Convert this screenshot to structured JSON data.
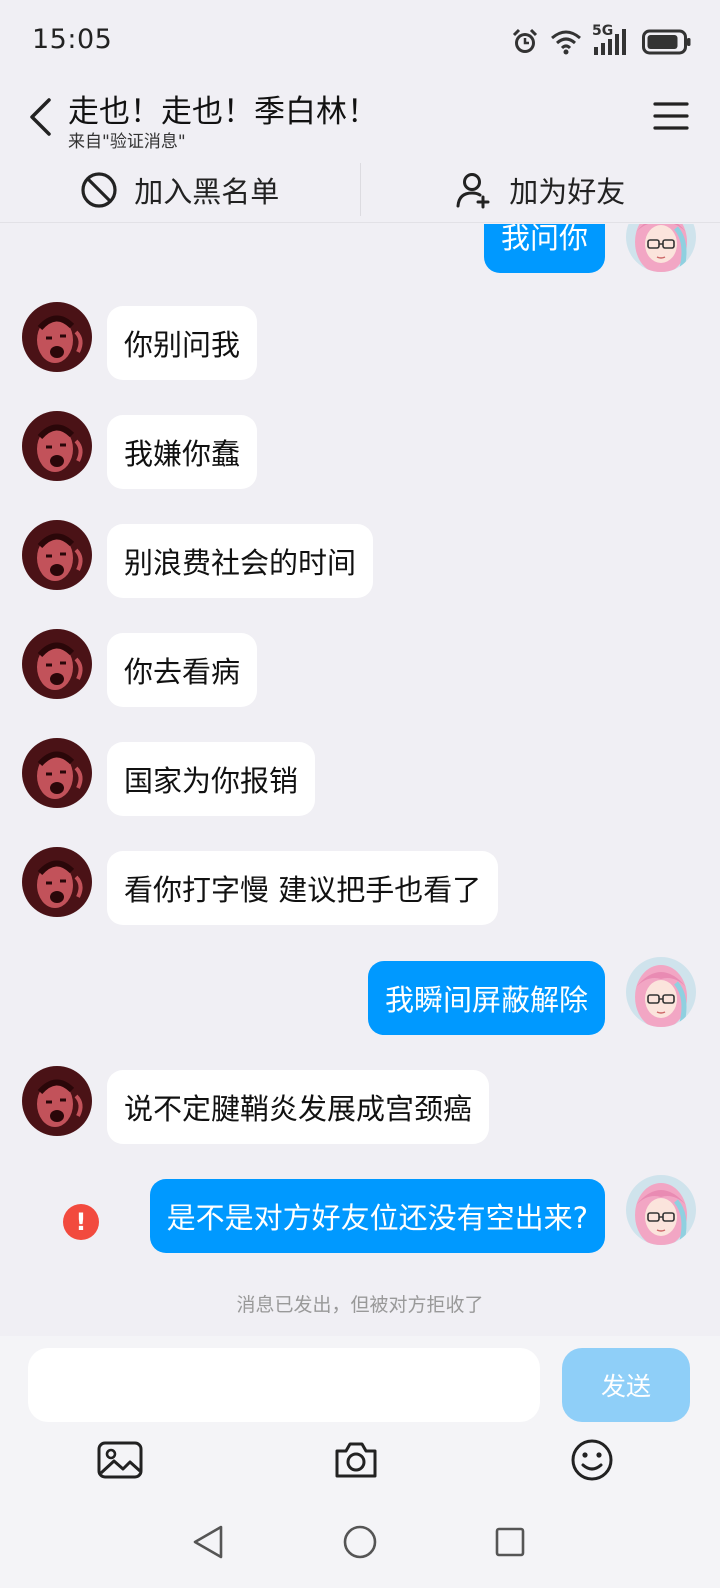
{
  "status_bar": {
    "time": "15:05",
    "network_label": "5G",
    "icons": [
      "alarm-icon",
      "wifi-icon",
      "signal-icon",
      "battery-icon"
    ]
  },
  "header": {
    "title": "走也！走也！季白林！",
    "subtitle": "来自\"验证消息\"",
    "back_icon": "chevron-left-icon",
    "menu_icon": "hamburger-menu-icon"
  },
  "actions": {
    "blacklist_label": "加入黑名单",
    "add_friend_label": "加为好友"
  },
  "messages": [
    {
      "side": "out",
      "text": "我问你"
    },
    {
      "side": "in",
      "text": "你别问我"
    },
    {
      "side": "in",
      "text": "我嫌你蠢"
    },
    {
      "side": "in",
      "text": "别浪费社会的时间"
    },
    {
      "side": "in",
      "text": "你去看病"
    },
    {
      "side": "in",
      "text": "国家为你报销"
    },
    {
      "side": "in",
      "text": "看你打字慢 建议把手也看了"
    },
    {
      "side": "out",
      "text": "我瞬间屏蔽解除"
    },
    {
      "side": "in",
      "text": "说不定腱鞘炎发展成宫颈癌"
    },
    {
      "side": "out",
      "text": "是不是对方好友位还没有空出来?",
      "failed": true
    }
  ],
  "failed_notice": "消息已发出，但被对方拒收了",
  "input": {
    "value": "",
    "send_label": "发送"
  },
  "toolbar": [
    "image-icon",
    "camera-icon",
    "emoji-icon"
  ],
  "nav": [
    "nav-back-icon",
    "nav-home-icon",
    "nav-recents-icon"
  ],
  "colors": {
    "accent": "#0099ff",
    "background": "#f0eff4",
    "send_disabled": "#8fcff8",
    "error": "#f24a3e"
  }
}
